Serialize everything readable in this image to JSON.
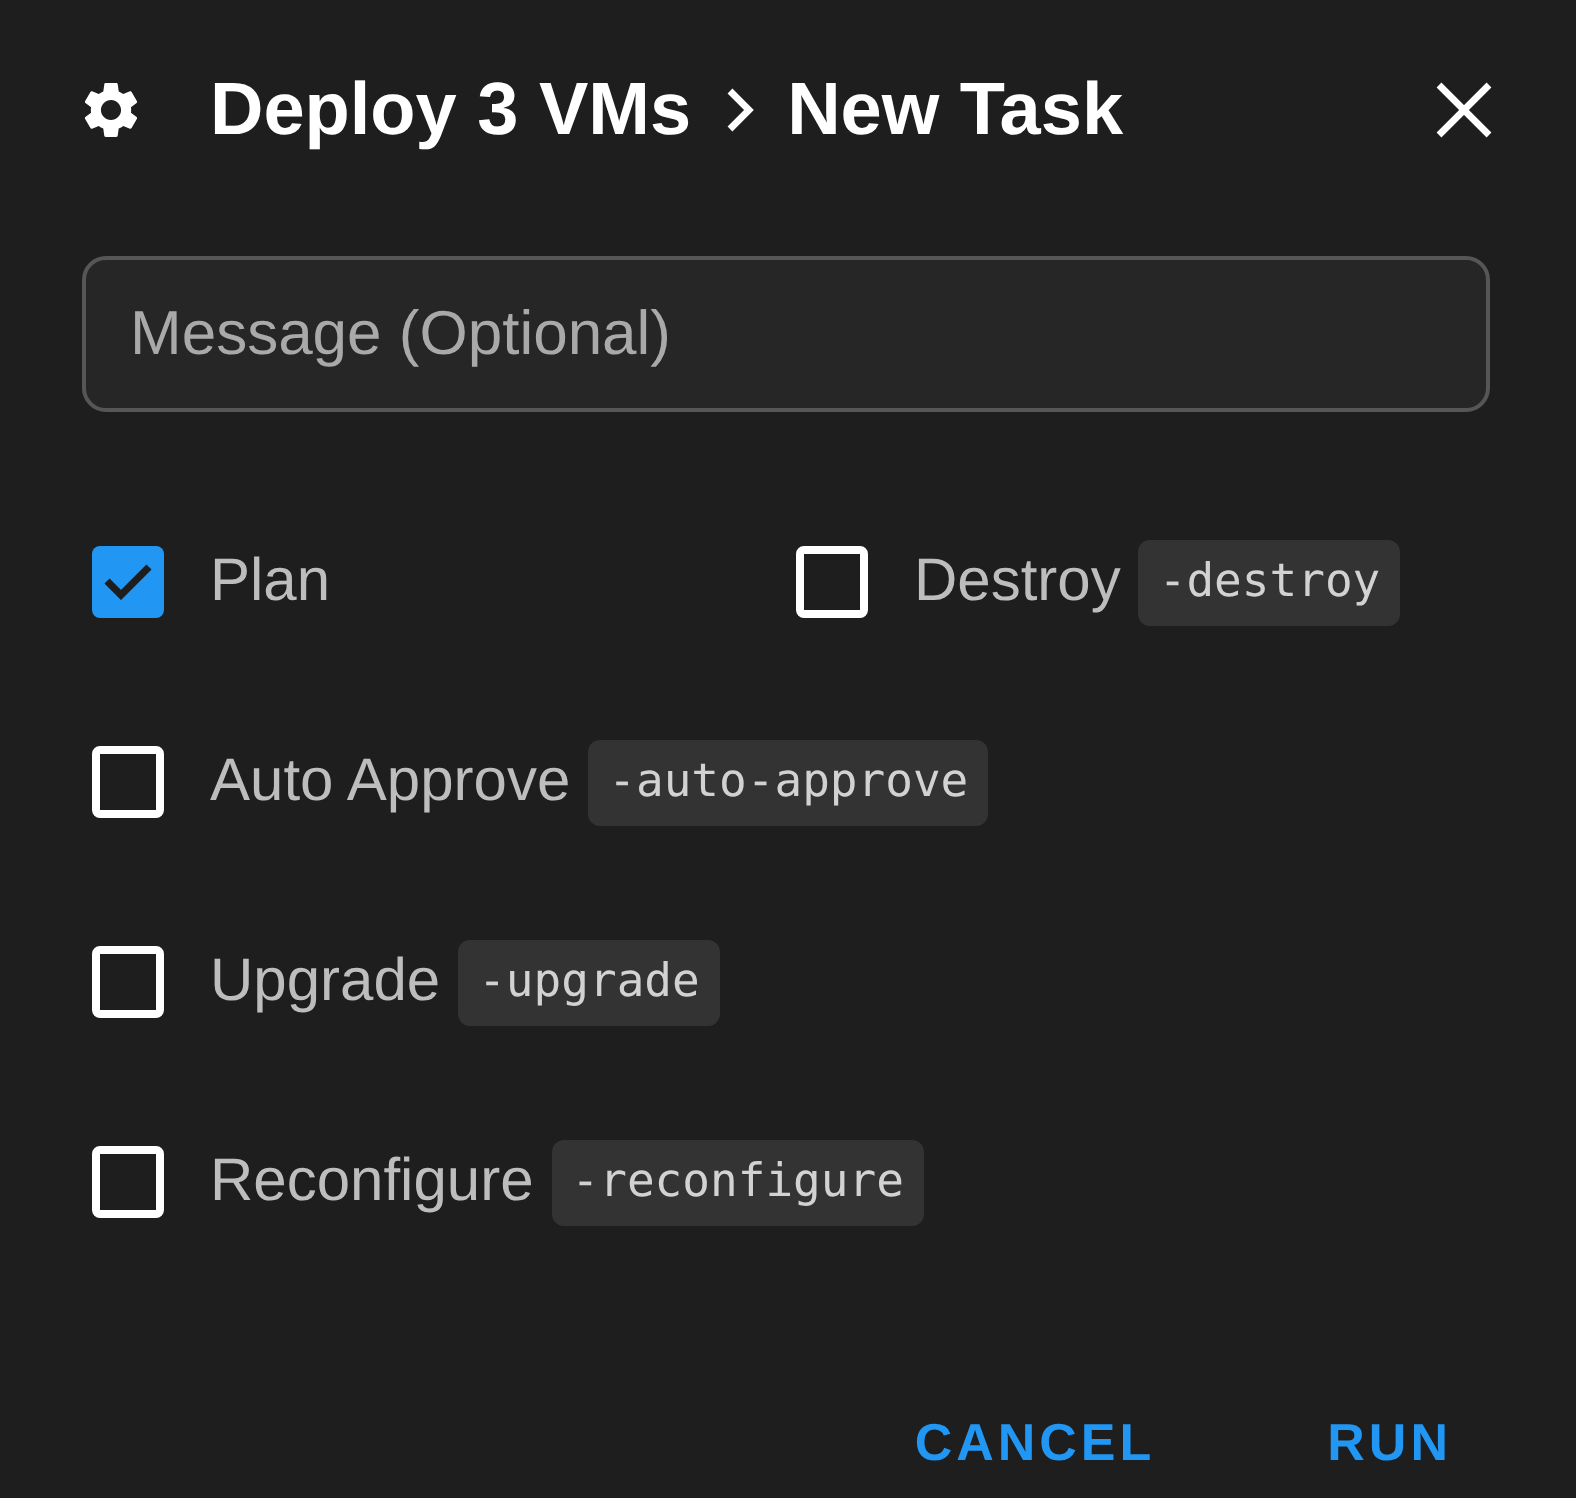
{
  "dialog": {
    "breadcrumb": [
      "Deploy 3 VMs",
      "New Task"
    ]
  },
  "message_field": {
    "placeholder": "Message (Optional)"
  },
  "option_rows": [
    {
      "options": [
        {
          "label": "Plan",
          "checked": true
        },
        {
          "label": "Destroy",
          "flag": "-destroy",
          "checked": false
        }
      ]
    },
    {
      "options": [
        {
          "label": "Auto Approve",
          "flag": "-auto-approve",
          "checked": false
        }
      ]
    },
    {
      "options": [
        {
          "label": "Upgrade",
          "flag": "-upgrade",
          "checked": false
        }
      ]
    },
    {
      "options": [
        {
          "label": "Reconfigure",
          "flag": "-reconfigure",
          "checked": false
        }
      ]
    }
  ],
  "buttons": [
    {
      "label": "CANCEL"
    },
    {
      "label": "RUN"
    }
  ]
}
